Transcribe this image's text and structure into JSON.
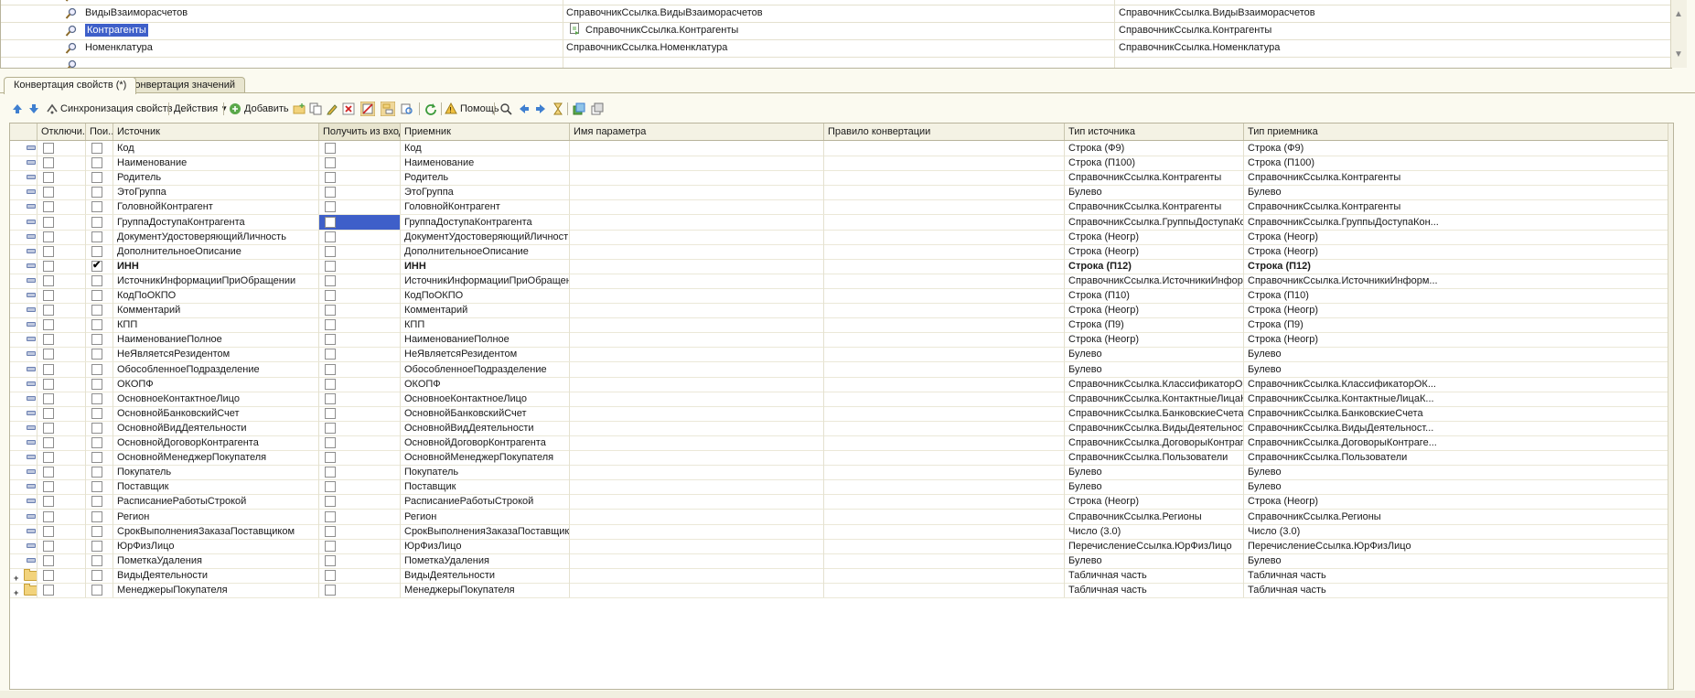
{
  "top_list": {
    "rows": [
      {
        "name": "",
        "ref": "",
        "ref_type": ""
      },
      {
        "name": "ВидыВзаиморасчетов",
        "ref": "СправочникСсылка.ВидыВзаиморасчетов",
        "ref_type": "СправочникСсылка.ВидыВзаиморасчетов"
      },
      {
        "name": "Контрагенты",
        "ref": "СправочникСсылка.Контрагенты",
        "ref_type": "СправочникСсылка.Контрагенты"
      },
      {
        "name": "Номенклатура",
        "ref": "СправочникСсылка.Номенклатура",
        "ref_type": "СправочникСсылка.Номенклатура"
      },
      {
        "name": "",
        "ref": "",
        "ref_type": ""
      }
    ]
  },
  "tabs": [
    {
      "label": "Конвертация свойств (*)"
    },
    {
      "label": "Конвертация значений"
    }
  ],
  "toolbar": {
    "sync_label": "Синхронизация свойств ...",
    "actions_label": "Действия",
    "add_label": "Добавить",
    "help_label": "Помощь"
  },
  "grid": {
    "columns": {
      "disabled": "Отключи...",
      "search": "Пои...",
      "source": "Источник",
      "get_from_incoming": "Получить из вход...",
      "receiver": "Приемник",
      "param_name": "Имя параметра",
      "conv_rule": "Правило конвертации",
      "source_type": "Тип источника",
      "receiver_type": "Тип приемника"
    },
    "rows": [
      {
        "source": "Код",
        "receiver": "Код",
        "source_type": "Строка (Ф9)",
        "receiver_type": "Строка (Ф9)",
        "search": false,
        "bold": false
      },
      {
        "source": "Наименование",
        "receiver": "Наименование",
        "source_type": "Строка (П100)",
        "receiver_type": "Строка (П100)",
        "search": false,
        "bold": false
      },
      {
        "source": "Родитель",
        "receiver": "Родитель",
        "source_type": "СправочникСсылка.Контрагенты",
        "receiver_type": "СправочникСсылка.Контрагенты",
        "search": false,
        "bold": false
      },
      {
        "source": "ЭтоГруппа",
        "receiver": "ЭтоГруппа",
        "source_type": "Булево",
        "receiver_type": "Булево",
        "search": false,
        "bold": false
      },
      {
        "source": "ГоловнойКонтрагент",
        "receiver": "ГоловнойКонтрагент",
        "source_type": "СправочникСсылка.Контрагенты",
        "receiver_type": "СправочникСсылка.Контрагенты",
        "search": false,
        "bold": false
      },
      {
        "source": "ГруппаДоступаКонтрагента",
        "receiver": "ГруппаДоступаКонтрагента",
        "source_type": "СправочникСсылка.ГруппыДоступаКонтр...",
        "receiver_type": "СправочникСсылка.ГруппыДоступаКон...",
        "search": false,
        "bold": false
      },
      {
        "source": "ДокументУдостоверяющийЛичность",
        "receiver": "ДокументУдостоверяющийЛичность",
        "source_type": "Строка (Неогр)",
        "receiver_type": "Строка (Неогр)",
        "search": false,
        "bold": false
      },
      {
        "source": "ДополнительноеОписание",
        "receiver": "ДополнительноеОписание",
        "source_type": "Строка (Неогр)",
        "receiver_type": "Строка (Неогр)",
        "search": false,
        "bold": false
      },
      {
        "source": "ИНН",
        "receiver": "ИНН",
        "source_type": "Строка (П12)",
        "receiver_type": "Строка (П12)",
        "search": true,
        "bold": true
      },
      {
        "source": "ИсточникИнформацииПриОбращении",
        "receiver": "ИсточникИнформацииПриОбращении",
        "source_type": "СправочникСсылка.ИсточникиИнформаци...",
        "receiver_type": "СправочникСсылка.ИсточникиИнформ...",
        "search": false,
        "bold": false
      },
      {
        "source": "КодПоОКПО",
        "receiver": "КодПоОКПО",
        "source_type": "Строка (П10)",
        "receiver_type": "Строка (П10)",
        "search": false,
        "bold": false
      },
      {
        "source": "Комментарий",
        "receiver": "Комментарий",
        "source_type": "Строка (Неогр)",
        "receiver_type": "Строка (Неогр)",
        "search": false,
        "bold": false
      },
      {
        "source": "КПП",
        "receiver": "КПП",
        "source_type": "Строка (П9)",
        "receiver_type": "Строка (П9)",
        "search": false,
        "bold": false
      },
      {
        "source": "НаименованиеПолное",
        "receiver": "НаименованиеПолное",
        "source_type": "Строка (Неогр)",
        "receiver_type": "Строка (Неогр)",
        "search": false,
        "bold": false
      },
      {
        "source": "НеЯвляетсяРезидентом",
        "receiver": "НеЯвляетсяРезидентом",
        "source_type": "Булево",
        "receiver_type": "Булево",
        "search": false,
        "bold": false
      },
      {
        "source": "ОбособленноеПодразделение",
        "receiver": "ОбособленноеПодразделение",
        "source_type": "Булево",
        "receiver_type": "Булево",
        "search": false,
        "bold": false
      },
      {
        "source": "ОКОПФ",
        "receiver": "ОКОПФ",
        "source_type": "СправочникСсылка.КлассификаторОКОПФ",
        "receiver_type": "СправочникСсылка.КлассификаторОК...",
        "search": false,
        "bold": false
      },
      {
        "source": "ОсновноеКонтактноеЛицо",
        "receiver": "ОсновноеКонтактноеЛицо",
        "source_type": "СправочникСсылка.КонтактныеЛицаКонт...",
        "receiver_type": "СправочникСсылка.КонтактныеЛицаК...",
        "search": false,
        "bold": false
      },
      {
        "source": "ОсновнойБанковскийСчет",
        "receiver": "ОсновнойБанковскийСчет",
        "source_type": "СправочникСсылка.БанковскиеСчета",
        "receiver_type": "СправочникСсылка.БанковскиеСчета",
        "search": false,
        "bold": false
      },
      {
        "source": "ОсновнойВидДеятельности",
        "receiver": "ОсновнойВидДеятельности",
        "source_type": "СправочникСсылка.ВидыДеятельностиКо...",
        "receiver_type": "СправочникСсылка.ВидыДеятельност...",
        "search": false,
        "bold": false
      },
      {
        "source": "ОсновнойДоговорКонтрагента",
        "receiver": "ОсновнойДоговорКонтрагента",
        "source_type": "СправочникСсылка.ДоговорыКонтрагентов",
        "receiver_type": "СправочникСсылка.ДоговорыКонтраге...",
        "search": false,
        "bold": false
      },
      {
        "source": "ОсновнойМенеджерПокупателя",
        "receiver": "ОсновнойМенеджерПокупателя",
        "source_type": "СправочникСсылка.Пользователи",
        "receiver_type": "СправочникСсылка.Пользователи",
        "search": false,
        "bold": false
      },
      {
        "source": "Покупатель",
        "receiver": "Покупатель",
        "source_type": "Булево",
        "receiver_type": "Булево",
        "search": false,
        "bold": false
      },
      {
        "source": "Поставщик",
        "receiver": "Поставщик",
        "source_type": "Булево",
        "receiver_type": "Булево",
        "search": false,
        "bold": false
      },
      {
        "source": "РасписаниеРаботыСтрокой",
        "receiver": "РасписаниеРаботыСтрокой",
        "source_type": "Строка (Неогр)",
        "receiver_type": "Строка (Неогр)",
        "search": false,
        "bold": false
      },
      {
        "source": "Регион",
        "receiver": "Регион",
        "source_type": "СправочникСсылка.Регионы",
        "receiver_type": "СправочникСсылка.Регионы",
        "search": false,
        "bold": false
      },
      {
        "source": "СрокВыполненияЗаказаПоставщиком",
        "receiver": "СрокВыполненияЗаказаПоставщиком",
        "source_type": "Число (3.0)",
        "receiver_type": "Число (3.0)",
        "search": false,
        "bold": false
      },
      {
        "source": "ЮрФизЛицо",
        "receiver": "ЮрФизЛицо",
        "source_type": "ПеречислениеСсылка.ЮрФизЛицо",
        "receiver_type": "ПеречислениеСсылка.ЮрФизЛицо",
        "search": false,
        "bold": false
      },
      {
        "source": "ПометкаУдаления",
        "receiver": "ПометкаУдаления",
        "source_type": "Булево",
        "receiver_type": "Булево",
        "search": false,
        "bold": false
      },
      {
        "source": "ВидыДеятельности",
        "receiver": "ВидыДеятельности",
        "source_type": "Табличная часть",
        "receiver_type": "Табличная часть",
        "search": false,
        "bold": false,
        "folder": true
      },
      {
        "source": "МенеджерыПокупателя",
        "receiver": "МенеджерыПокупателя",
        "source_type": "Табличная часть",
        "receiver_type": "Табличная часть",
        "search": false,
        "bold": false,
        "folder": true
      }
    ]
  },
  "colors": {
    "selection": "#3e5fc9",
    "panel_bg": "#fbfaf0",
    "border": "#b8b49c"
  }
}
